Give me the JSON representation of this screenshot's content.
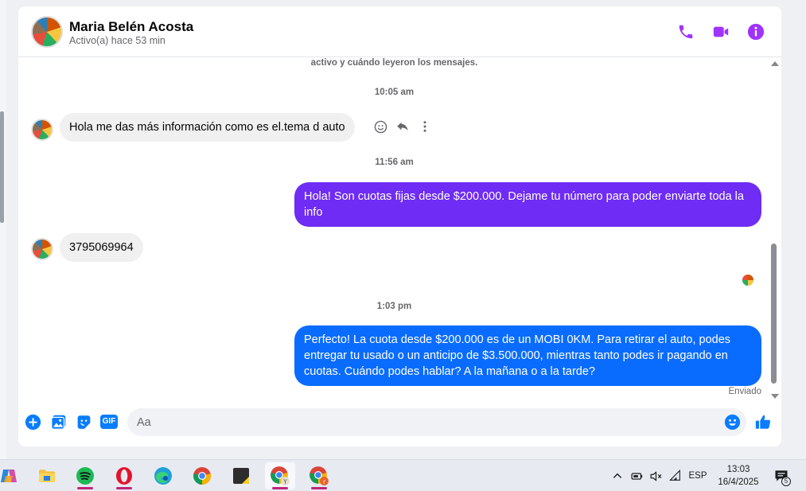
{
  "conversation": {
    "contact_name": "Maria Belén Acosta",
    "contact_status": "Activo(a) hace 53 min",
    "system_note": "activo y cuándo leyeron los mensajes.",
    "messages": [
      {
        "time": "10:05 am",
        "direction": "in",
        "text": "Hola me das más información como  es el.tema d auto"
      },
      {
        "time": "11:56 am",
        "direction": "out",
        "text": "Hola! Son cuotas fijas desde $200.000. Dejame tu número para poder enviarte toda la info"
      },
      {
        "direction": "in",
        "text": "3795069964"
      },
      {
        "time": "1:03 pm",
        "direction": "out",
        "text": "Perfecto! La cuota desde $200.000 es de un MOBI 0KM. Para retirar el auto, podes entregar tu usado o un anticipo de $3.500.000, mientras tanto podes ir pagando en cuotas. Cuándo podes hablar? A la mañana o a la tarde?"
      }
    ],
    "delivery_status": "Enviado"
  },
  "composer": {
    "placeholder": "Aa",
    "gif_label": "GIF"
  },
  "header_actions": [
    "phone-icon",
    "video-call-icon",
    "info-icon"
  ],
  "composer_actions": [
    "plus-icon",
    "photo-icon",
    "sticker-icon",
    "gif-icon",
    "emoji-icon",
    "like-icon"
  ],
  "colors": {
    "accent_purple": "#a033ff",
    "outgoing_purple": "#6e2cf4",
    "outgoing_blue": "#0a6cff",
    "incoming_bg": "#f0f0f0",
    "composer_icon_blue": "#0a7cff"
  },
  "taskbar": {
    "apps": [
      "copilot",
      "file-explorer",
      "spotify",
      "opera",
      "edge",
      "chrome",
      "sticky-notes",
      "chrome-profile-y",
      "chrome-profile-r"
    ],
    "language": "ESP",
    "time": "13:03",
    "date": "16/4/2025",
    "notification_count": "5"
  }
}
